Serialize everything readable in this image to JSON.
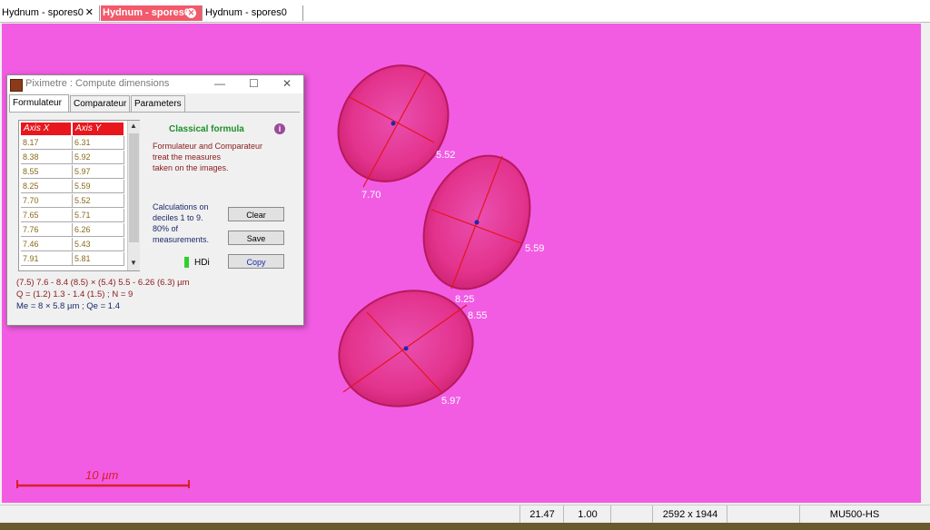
{
  "tabs": [
    {
      "label": "Hydnum - spores0",
      "close": "✕",
      "active": false
    },
    {
      "label": "Hydnum - spores0",
      "close": "✕",
      "active": true
    },
    {
      "label": "Hydnum - spores0",
      "close": "",
      "active": false
    }
  ],
  "viewer": {
    "background": "#f25ce3",
    "spore_color": "#e0237a",
    "line_color": "#e4151f",
    "measure_labels": [
      "7.70",
      "5.52",
      "5.59",
      "8.25",
      "8.55",
      "5.97"
    ],
    "scale_label": "10 µm"
  },
  "dialog": {
    "title": "Piximetre : Compute dimensions",
    "min": "—",
    "max": "☐",
    "close": "✕",
    "tabs": [
      "Formulateur",
      "Comparateur",
      "Parameters"
    ],
    "table": {
      "headers": [
        "Axis X",
        "Axis Y"
      ],
      "rows": [
        [
          "8.17",
          "6.31"
        ],
        [
          "8.38",
          "5.92"
        ],
        [
          "8.55",
          "5.97"
        ],
        [
          "8.25",
          "5.59"
        ],
        [
          "7.70",
          "5.52"
        ],
        [
          "7.65",
          "5.71"
        ],
        [
          "7.76",
          "6.26"
        ],
        [
          "7.46",
          "5.43"
        ],
        [
          "7.91",
          "5.81"
        ]
      ]
    },
    "classical_title": "Classical formula",
    "info_icon": "i",
    "description": [
      "Formulateur and Comparateur",
      "treat the measures",
      "taken on the images."
    ],
    "calc_note": [
      "Calculations on",
      "deciles 1 to 9.",
      "80% of",
      "measurements."
    ],
    "buttons": {
      "clear": "Clear",
      "save": "Save",
      "copy": "Copy"
    },
    "hdi_label": "HDi",
    "result_line1": "(7.5) 7.6 - 8.4 (8.5) × (5.4) 5.5 - 6.26 (6.3) µm",
    "result_line2": "Q = (1.2) 1.3 - 1.4 (1.5) ; N = 9",
    "result_line3": "Me = 8 × 5.8 µm ; Qe = 1.4"
  },
  "statusbar": {
    "value1": "21.47",
    "value2": "1.00",
    "resolution": "2592 x 1944",
    "camera": "MU500-HS"
  }
}
